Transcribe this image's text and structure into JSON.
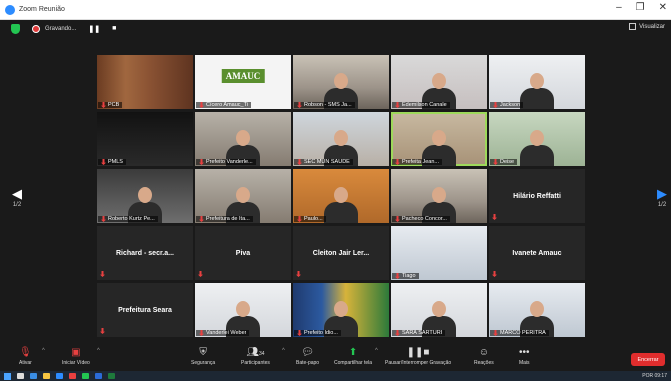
{
  "window": {
    "title": "Zoom Reunião"
  },
  "recording": {
    "label": "Gravando...",
    "pause": "❚❚",
    "stop": "■"
  },
  "view_button": {
    "label": "Visualizar"
  },
  "pager": {
    "left": "1/2",
    "right": "1/2"
  },
  "tiles": [
    {
      "name": "PCB",
      "kind": "video",
      "bg": "bg-wood",
      "person": false
    },
    {
      "name": "Cícero Amauc_Ti",
      "kind": "video",
      "bg": "bg-logo",
      "logo": "AMAUC"
    },
    {
      "name": "Robson - SMS Ja...",
      "kind": "video",
      "bg": "bg-office",
      "person": true
    },
    {
      "name": "Edemilson Canale",
      "kind": "video",
      "bg": "bg-pink",
      "person": true
    },
    {
      "name": "Jackson",
      "kind": "video",
      "bg": "bg-white",
      "person": true
    },
    {
      "name": "PMLS",
      "kind": "video",
      "bg": "bg-dark",
      "person": false
    },
    {
      "name": "Prefeito Vanderle...",
      "kind": "video",
      "bg": "bg-room",
      "person": true
    },
    {
      "name": "SEC MUN SAUDE",
      "kind": "video",
      "bg": "bg-window",
      "person": true
    },
    {
      "name": "Prefeita Jean...",
      "kind": "video",
      "bg": "bg-warm",
      "person": true,
      "active": true
    },
    {
      "name": "Deise",
      "kind": "video",
      "bg": "bg-green",
      "person": true
    },
    {
      "name": "Roberto Kurtz Pe...",
      "kind": "video",
      "bg": "bg-ppt",
      "person": true
    },
    {
      "name": "Prefeitura de Ita...",
      "kind": "video",
      "bg": "bg-room",
      "person": true
    },
    {
      "name": "Paulo...",
      "kind": "video",
      "bg": "bg-orange",
      "person": true
    },
    {
      "name": "Pacheco Concor...",
      "kind": "video",
      "bg": "bg-office",
      "person": true
    },
    {
      "name": "Hilário Reffatti",
      "kind": "name"
    },
    {
      "name": "Richard - secr.a...",
      "kind": "name"
    },
    {
      "name": "Piva",
      "kind": "name"
    },
    {
      "name": "Cleiton Jair Ler...",
      "kind": "name"
    },
    {
      "name": "Tiago",
      "kind": "video",
      "bg": "bg-blue",
      "person": false
    },
    {
      "name": "Ivanete Amauc",
      "kind": "name"
    },
    {
      "name": "Prefeitura Seara",
      "kind": "name"
    },
    {
      "name": "Vanderlei Weber",
      "kind": "video",
      "bg": "bg-white",
      "person": true
    },
    {
      "name": "Prefeito Idio...",
      "kind": "video",
      "bg": "bg-flags",
      "person": true
    },
    {
      "name": "SARA SARTURI",
      "kind": "video",
      "bg": "bg-white",
      "person": true
    },
    {
      "name": "MARCO PERITRA",
      "kind": "video",
      "bg": "bg-blue",
      "person": true
    }
  ],
  "toolbar": {
    "mute": "Ativar",
    "video": "Iniciar Vídeo",
    "security": "Segurança",
    "participants": "Participantes",
    "participants_count": "34",
    "chat": "Bate-papo",
    "share": "Compartilhar tela",
    "record": "Pausar/Interromper Gravação",
    "reactions": "Reações",
    "more": "Mais",
    "end": "Encerrar"
  },
  "taskbar": {
    "tray": "POR  09:17"
  }
}
